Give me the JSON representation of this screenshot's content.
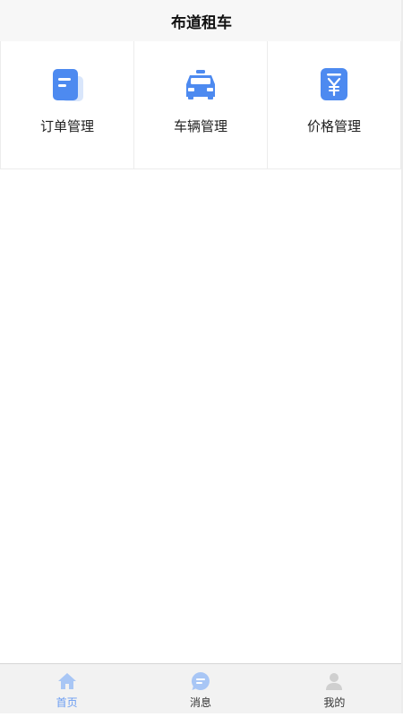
{
  "header": {
    "title": "布道租车"
  },
  "menu": {
    "items": [
      {
        "label": "订单管理",
        "icon": "order-document-icon"
      },
      {
        "label": "车辆管理",
        "icon": "car-icon"
      },
      {
        "label": "价格管理",
        "icon": "price-yen-icon"
      }
    ]
  },
  "tabbar": {
    "items": [
      {
        "label": "首页",
        "icon": "home-icon",
        "active": true
      },
      {
        "label": "消息",
        "icon": "message-icon",
        "active": false
      },
      {
        "label": "我的",
        "icon": "user-icon",
        "active": false
      }
    ]
  },
  "colors": {
    "accent": "#4d8af0",
    "accent_light": "#a8c6f5",
    "tab_active": "#6a9cf2",
    "tab_inactive_icon": "#cfcfcf"
  }
}
